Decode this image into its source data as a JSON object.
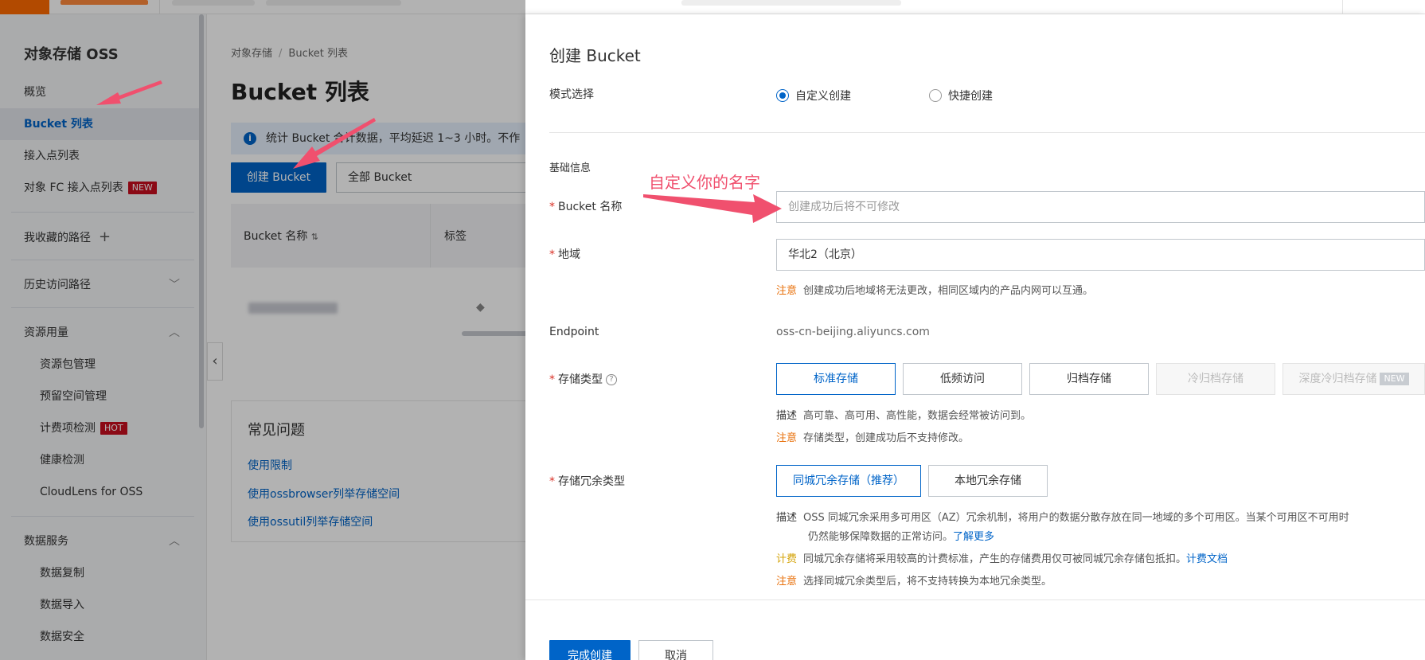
{
  "sidebar": {
    "title": "对象存储 OSS",
    "items": {
      "overview": "概览",
      "bucket_list": "Bucket 列表",
      "access_points": "接入点列表",
      "fc_access_points": "对象 FC 接入点列表",
      "favorites": "我收藏的路径",
      "history": "历史访问路径",
      "resource_usage": "资源用量",
      "resource_pack": "资源包管理",
      "reserved_space": "预留空间管理",
      "billing_check": "计费项检测",
      "health_check": "健康检测",
      "cloudlens": "CloudLens for OSS",
      "data_services": "数据服务",
      "data_replication": "数据复制",
      "data_import": "数据导入",
      "data_security": "数据安全"
    },
    "badges": {
      "new": "NEW",
      "hot": "HOT"
    },
    "icons": {
      "plus": "+",
      "chevron_down": "﹀",
      "chevron_up": "︿"
    }
  },
  "main": {
    "breadcrumb": [
      "对象存储",
      "Bucket 列表"
    ],
    "breadcrumb_sep": "/",
    "page_title": "Bucket 列表",
    "notice_text": "统计 Bucket 合计数据，平均延迟 1~3 小时。不作",
    "create_button": "创建 Bucket",
    "filter_select": "全部 Bucket",
    "table_headers": [
      "Bucket 名称",
      "标签"
    ],
    "faq": {
      "title": "常见问题",
      "links": [
        "使用限制",
        "使用ossbrowser列举存储空间",
        "使用ossutil列举存储空间"
      ]
    }
  },
  "drawer": {
    "title": "创建 Bucket",
    "mode_label": "模式选择",
    "mode_options": [
      "自定义创建",
      "快捷创建"
    ],
    "mode_selected": "自定义创建",
    "section_basic": "基础信息",
    "bucket_name_label": "Bucket 名称",
    "bucket_name_placeholder": "创建成功后将不可修改",
    "region_label": "地域",
    "region_value": "华北2（北京）",
    "region_note_key": "注意",
    "region_note": "创建成功后地域将无法更改，相同区域内的产品内网可以互通。",
    "endpoint_label": "Endpoint",
    "endpoint_value": "oss-cn-beijing.aliyuncs.com",
    "storage_type_label": "存储类型",
    "storage_types": [
      "标准存储",
      "低频访问",
      "归档存储",
      "冷归档存储",
      "深度冷归档存储"
    ],
    "storage_type_new_badge": "NEW",
    "storage_desc_key": "描述",
    "storage_desc": "高可靠、高可用、高性能，数据会经常被访问到。",
    "storage_note_key": "注意",
    "storage_note": "存储类型，创建成功后不支持修改。",
    "redundancy_label": "存储冗余类型",
    "redundancy_options": [
      "同城冗余存储（推荐）",
      "本地冗余存储"
    ],
    "redundancy_desc_key": "描述",
    "redundancy_desc_line1": "OSS 同城冗余采用多可用区（AZ）冗余机制，将用户的数据分散存放在同一地域的多个可用区。当某个可用区不可用时",
    "redundancy_desc_line2": "仍然能够保障数据的正常访问。",
    "learn_more": "了解更多",
    "billing_key": "计费",
    "billing_note": "同城冗余存储将采用较高的计费标准，产生的存储费用仅可被同城冗余存储包抵扣。",
    "billing_doc": "计费文档",
    "redundancy_note_key": "注意",
    "redundancy_note": "选择同城冗余类型后，将不支持转换为本地冗余类型。",
    "confirm_button": "完成创建",
    "cancel_button": "取消"
  },
  "annotation": {
    "text": "自定义你的名字",
    "color": "#f0506e"
  },
  "colors": {
    "primary": "#0064c8",
    "brand": "#ff6a00",
    "warning": "#e8700b",
    "danger": "#d93026"
  }
}
